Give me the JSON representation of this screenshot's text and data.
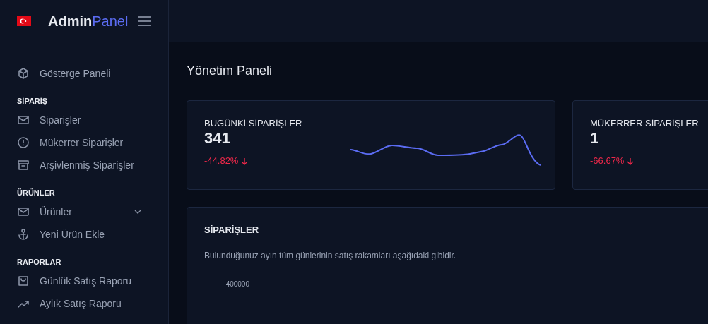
{
  "brand": {
    "title": "Admin",
    "title_accent": "Panel"
  },
  "sidebar": {
    "items": [
      {
        "kind": "link",
        "label": "Gösterge Paneli"
      },
      {
        "kind": "heading",
        "label": "SİPARİŞ"
      },
      {
        "kind": "link",
        "label": "Siparişler"
      },
      {
        "kind": "link",
        "label": "Mükerrer Siparişler"
      },
      {
        "kind": "link",
        "label": "Arşivlenmiş Siparişler"
      },
      {
        "kind": "heading",
        "label": "ÜRÜNLER"
      },
      {
        "kind": "group",
        "label": "Ürünler",
        "expanded": false
      },
      {
        "kind": "link",
        "label": "Yeni Ürün Ekle"
      },
      {
        "kind": "heading",
        "label": "RAPORLAR"
      },
      {
        "kind": "link",
        "label": "Günlük Satış Raporu"
      },
      {
        "kind": "link",
        "label": "Aylık Satış Raporu"
      }
    ]
  },
  "page_title": "Yönetim Paneli",
  "stats": [
    {
      "title": "BUGÜNKİ SİPARİŞLER",
      "value": "341",
      "change": "-44.82%",
      "falling": true,
      "sparkline": true
    },
    {
      "title": "MÜKERRER SİPARİŞLER",
      "value": "1",
      "change": "-66.67%",
      "falling": true,
      "sparkline": false
    }
  ],
  "orders_card": {
    "title": "SİPARİŞLER",
    "description": "Bulunduğunuz ayın tüm günlerinin satış rakamları aşağıdaki gibidir.",
    "y_tick": "400000"
  }
}
